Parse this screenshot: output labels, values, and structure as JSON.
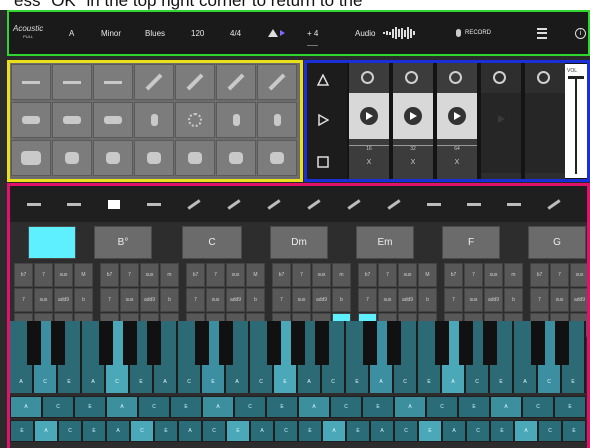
{
  "instruction_text": "ess \"OK\" in the top right corner to return to the",
  "topbar": {
    "logo_main": "Acoustic",
    "logo_sub": "PULL",
    "key": "A",
    "scale": "Minor",
    "style": "Blues",
    "tempo": "120",
    "time_signature": "4/4",
    "transpose": "+ 4",
    "audio_label": "Audio",
    "record_label": "RECORD",
    "info_label": "i"
  },
  "loops": {
    "counters": [
      "16",
      "32",
      "64"
    ],
    "clear_label": "X",
    "vol_label": "VOL"
  },
  "chords": [
    "B°",
    "C",
    "Dm",
    "Em",
    "F",
    "G"
  ],
  "chord_mod_labels": [
    "M",
    "m",
    "M",
    "m",
    "M",
    "m",
    "M"
  ],
  "variant_labels": [
    "b7",
    "7",
    "sus",
    "add9",
    "b",
    "#"
  ],
  "key_notes": [
    "A",
    "C",
    "E"
  ],
  "pad_notes_row1": [
    "A",
    "C",
    "E",
    "A",
    "C",
    "E",
    "A",
    "C",
    "E"
  ],
  "pad_notes_row2": [
    "E",
    "A",
    "C",
    "E",
    "A",
    "C",
    "E",
    "A",
    "C",
    "E",
    "A",
    "C",
    "E",
    "A"
  ],
  "colors": {
    "topbar_border": "#2fd62f",
    "drums_border": "#e9e01a",
    "loops_border": "#1a2fd8",
    "keys_border": "#e0126a",
    "accent_cyan": "#5ff0ff",
    "key_teal": "#2c6b76"
  },
  "icons": {
    "drums": [
      "hihat-icon",
      "crash-icon",
      "ride-icon",
      "stick-icon",
      "stick-icon",
      "stick-icon",
      "snare-icon",
      "snare-icon",
      "snare-icon",
      "hand-icon",
      "ring-icon",
      "shaker-icon",
      "bell-icon",
      "floor-tom-icon",
      "kick-icon",
      "tom-icon",
      "tom-icon",
      "tom-icon",
      "tom-icon",
      "tom-icon",
      "tom-icon"
    ],
    "instruments": [
      "speaker-icon",
      "pad-icon",
      "piano-icon",
      "harp-icon",
      "guitar-icon",
      "guitar-icon",
      "electric-guitar-icon",
      "bass-icon",
      "violin-icon",
      "sax-icon",
      "accordion-icon",
      "vibes-icon",
      "note-icon",
      "arrow-icon"
    ]
  }
}
